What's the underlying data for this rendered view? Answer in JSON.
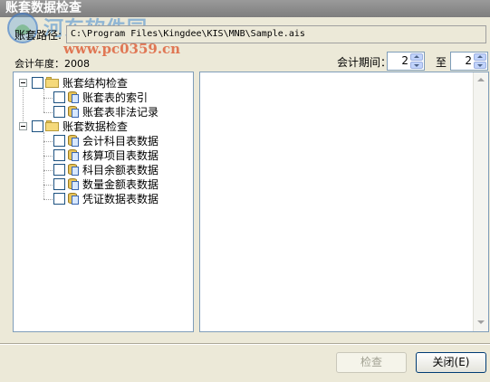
{
  "window": {
    "title": "账套数据检查"
  },
  "watermark": {
    "brand": "河东软件园",
    "url": "www.pc0359.cn"
  },
  "path": {
    "label": "账套路径:",
    "value": "C:\\Program Files\\Kingdee\\KIS\\MNB\\Sample.ais"
  },
  "year": {
    "label": "会计年度：2008"
  },
  "period": {
    "label": "会计期间：",
    "from": "2",
    "to_label": "至",
    "to": "2"
  },
  "tree": {
    "groups": [
      {
        "label": "账套结构检查",
        "items": [
          "账套表的索引",
          "账套表非法记录"
        ]
      },
      {
        "label": "账套数据检查",
        "items": [
          "会计科目表数据",
          "核算项目表数据",
          "科目余额表数据",
          "数量金额表数据",
          "凭证数据表数据"
        ]
      }
    ]
  },
  "buttons": {
    "check": "检查",
    "close": "关闭(E)"
  }
}
